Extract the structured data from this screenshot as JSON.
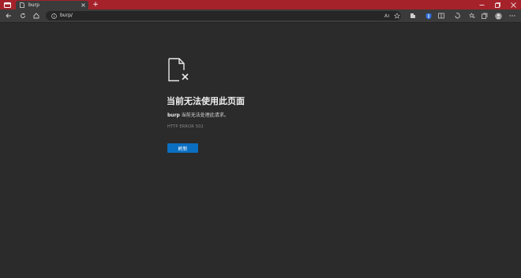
{
  "window": {
    "tab_title": "burp",
    "new_tab_symbol": "+"
  },
  "toolbar": {
    "url": "burp/"
  },
  "page": {
    "heading": "当前无法使用此页面",
    "host": "burp",
    "message": " 当前无法处理此请求。",
    "error_code": "HTTP ERROR 502",
    "reload_label": "刷新"
  },
  "colors": {
    "titlebar": "#a6222a",
    "toolbar": "#3b3b3b",
    "background": "#2b2b2b",
    "button": "#0a6fc2"
  }
}
